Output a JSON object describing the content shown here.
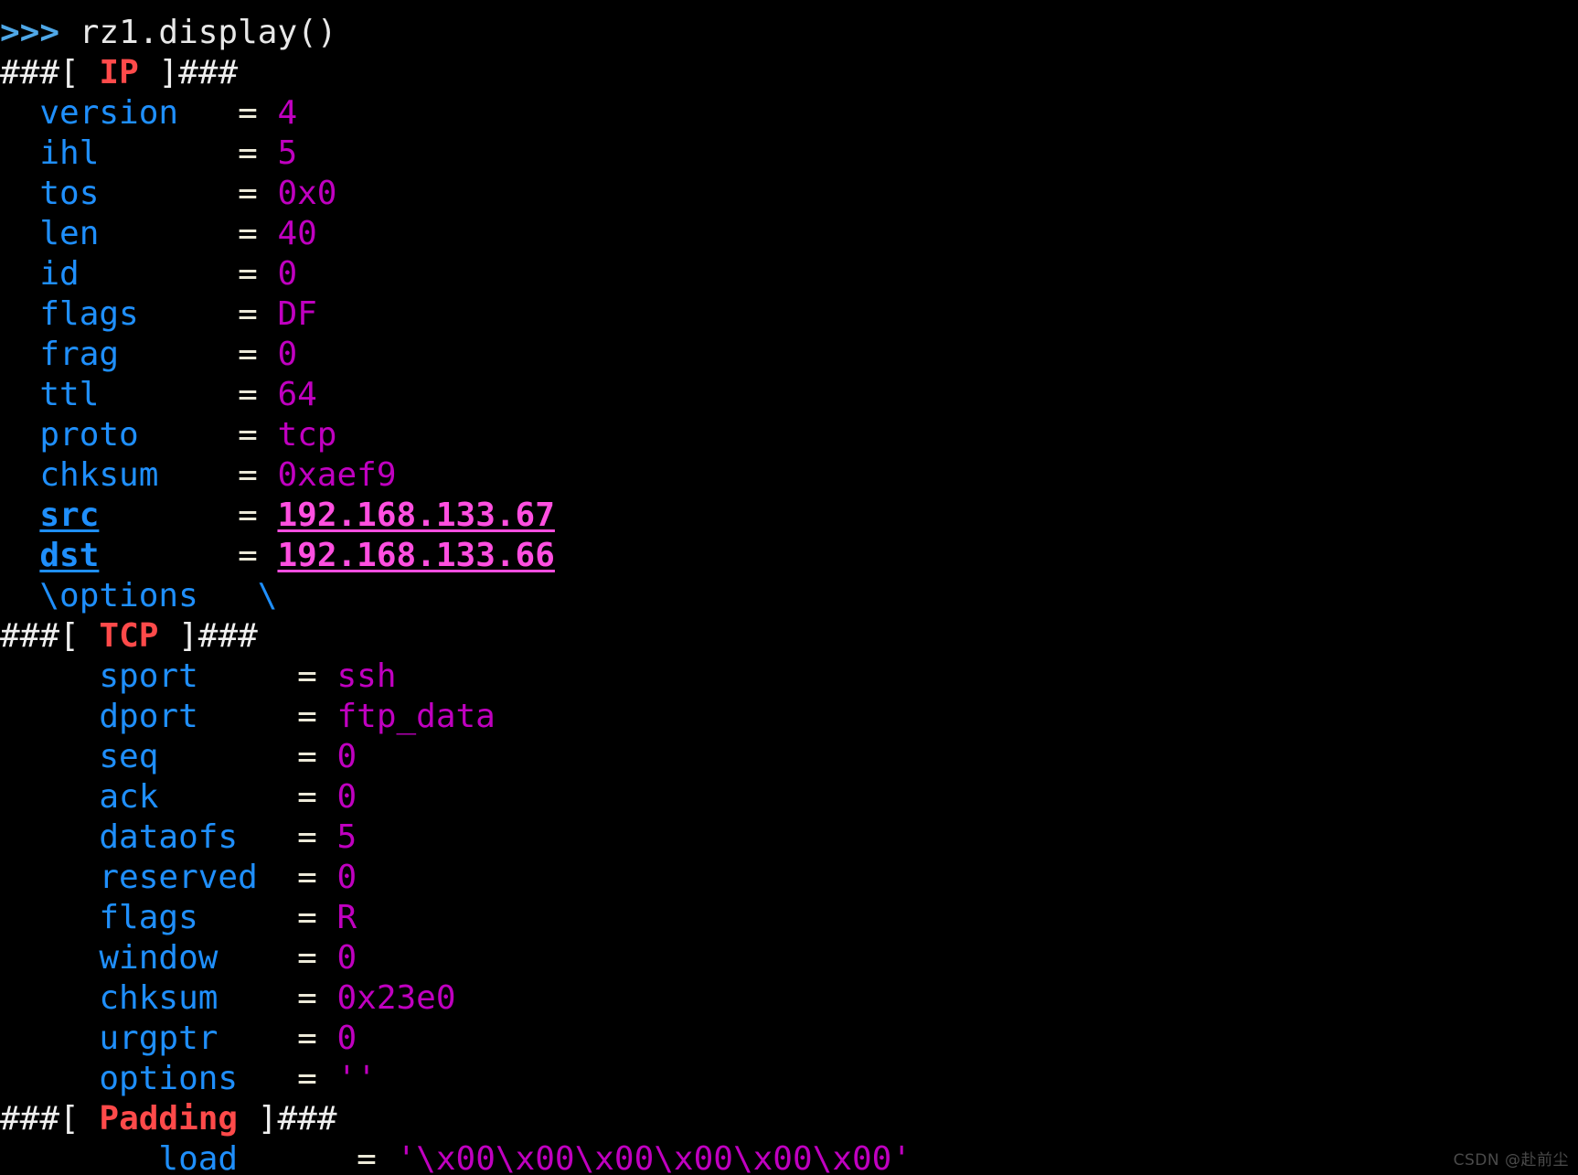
{
  "terminal": {
    "background": "#000000",
    "clipped_top_line": "                                                                      ",
    "colors": {
      "prompt": "#4fa8e8",
      "command": "#e8e8e8",
      "hashes": "#efefef",
      "protocol": "#ff4a4a",
      "field": "#1f8ffc",
      "field_emphasis": "#1f8ffc",
      "equals": "#ece9d8",
      "value": "#c000c0",
      "value_emphasis": "#ff4fe0"
    }
  },
  "command_line": {
    "prompt": ">>>",
    "command": "rz1.display()"
  },
  "layers": [
    {
      "name": "IP",
      "header_prefix": "###[",
      "header_suffix": "]###",
      "indent": "  ",
      "eq_column": 12,
      "fields": [
        {
          "name": "version",
          "value": "4",
          "emphasis": false
        },
        {
          "name": "ihl",
          "value": "5",
          "emphasis": false
        },
        {
          "name": "tos",
          "value": "0x0",
          "emphasis": false
        },
        {
          "name": "len",
          "value": "40",
          "emphasis": false
        },
        {
          "name": "id",
          "value": "0",
          "emphasis": false
        },
        {
          "name": "flags",
          "value": "DF",
          "emphasis": false
        },
        {
          "name": "frag",
          "value": "0",
          "emphasis": false
        },
        {
          "name": "ttl",
          "value": "64",
          "emphasis": false
        },
        {
          "name": "proto",
          "value": "tcp",
          "emphasis": false
        },
        {
          "name": "chksum",
          "value": "0xaef9",
          "emphasis": false
        },
        {
          "name": "src",
          "value": "192.168.133.67",
          "emphasis": true
        },
        {
          "name": "dst",
          "value": "192.168.133.66",
          "emphasis": true
        }
      ],
      "sublayer": "\\options   \\"
    },
    {
      "name": "TCP",
      "header_prefix": "###[",
      "header_suffix": "]###",
      "indent": "     ",
      "eq_column": 13,
      "fields": [
        {
          "name": "sport",
          "value": "ssh",
          "emphasis": false
        },
        {
          "name": "dport",
          "value": "ftp_data",
          "emphasis": false
        },
        {
          "name": "seq",
          "value": "0",
          "emphasis": false
        },
        {
          "name": "ack",
          "value": "0",
          "emphasis": false
        },
        {
          "name": "dataofs",
          "value": "5",
          "emphasis": false
        },
        {
          "name": "reserved",
          "value": "0",
          "emphasis": false
        },
        {
          "name": "flags",
          "value": "R",
          "emphasis": false
        },
        {
          "name": "window",
          "value": "0",
          "emphasis": false
        },
        {
          "name": "chksum",
          "value": "0x23e0",
          "emphasis": false
        },
        {
          "name": "urgptr",
          "value": "0",
          "emphasis": false
        },
        {
          "name": "options",
          "value": "''",
          "emphasis": false
        }
      ],
      "sublayer": null
    },
    {
      "name": "Padding",
      "header_prefix": "###[",
      "header_suffix": "]###",
      "indent": "        ",
      "eq_column": 14,
      "fields": [
        {
          "name": "load",
          "value": "'\\x00\\x00\\x00\\x00\\x00\\x00'",
          "emphasis": false
        }
      ],
      "sublayer": null
    }
  ],
  "watermark": {
    "text": "CSDN @赴前尘"
  }
}
